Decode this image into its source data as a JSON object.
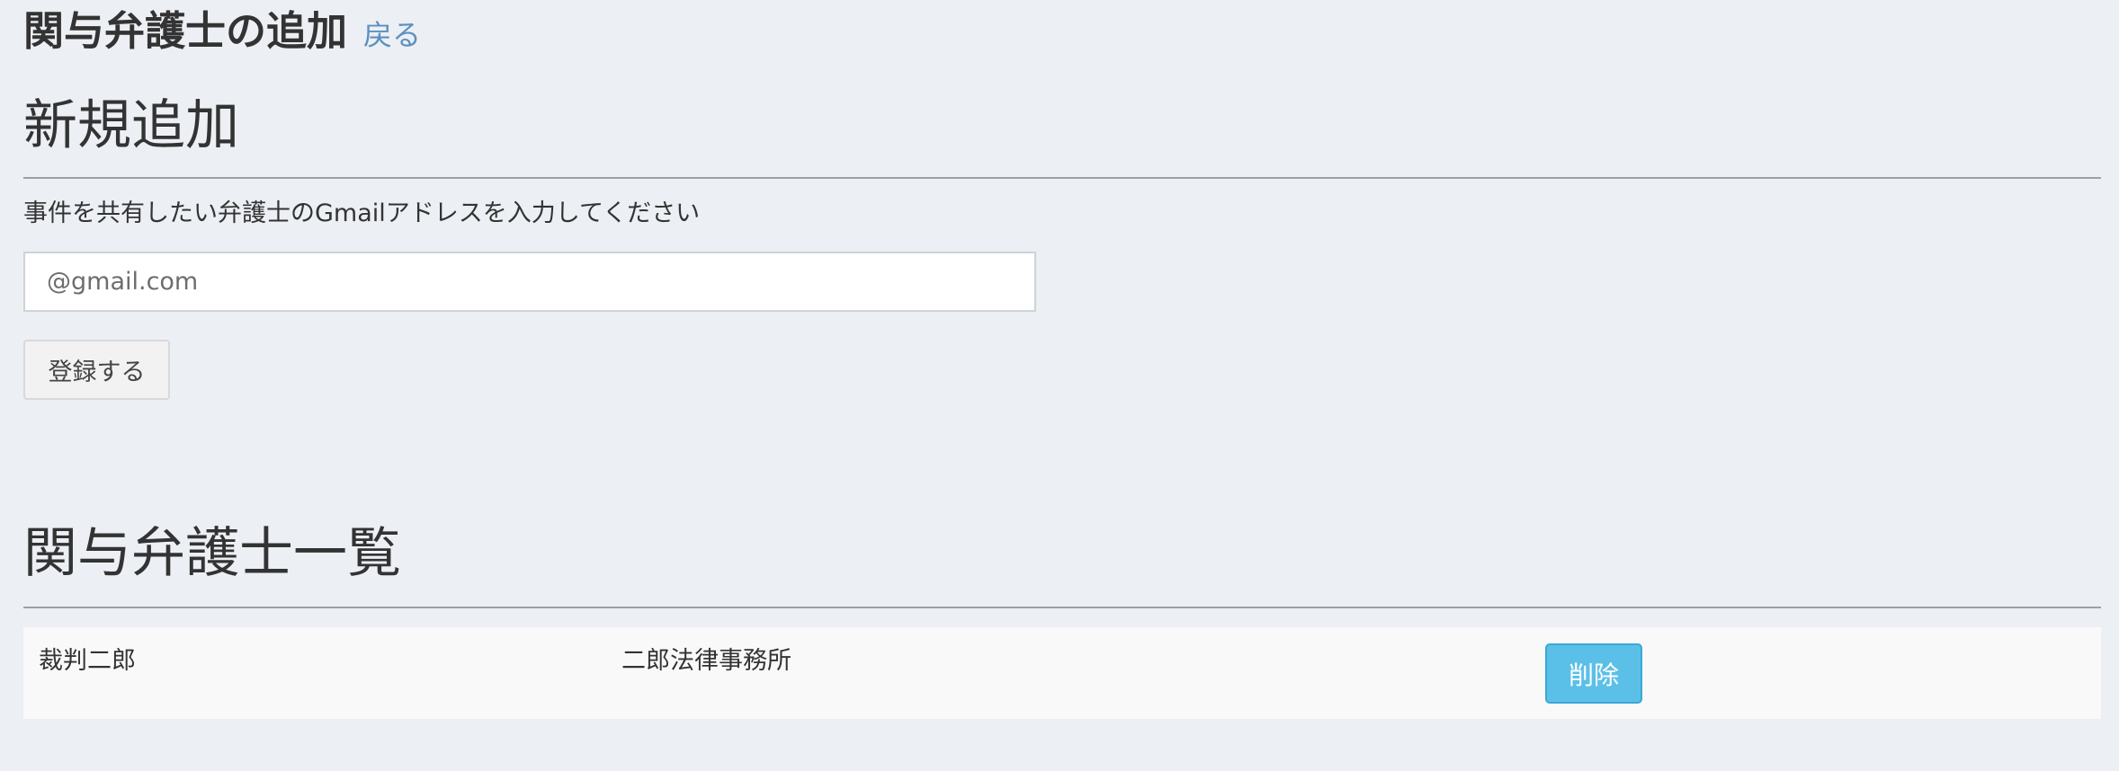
{
  "header": {
    "title": "関与弁護士の追加",
    "back_link": "戻る"
  },
  "new_section": {
    "heading": "新規追加",
    "instruction": "事件を共有したい弁護士のGmailアドレスを入力してください",
    "email_placeholder": "@gmail.com",
    "email_value": "",
    "submit_label": "登録する"
  },
  "list_section": {
    "heading": "関与弁護士一覧",
    "rows": [
      {
        "name": "裁判二郎",
        "firm": "二郎法律事務所",
        "delete_label": "削除"
      }
    ]
  }
}
